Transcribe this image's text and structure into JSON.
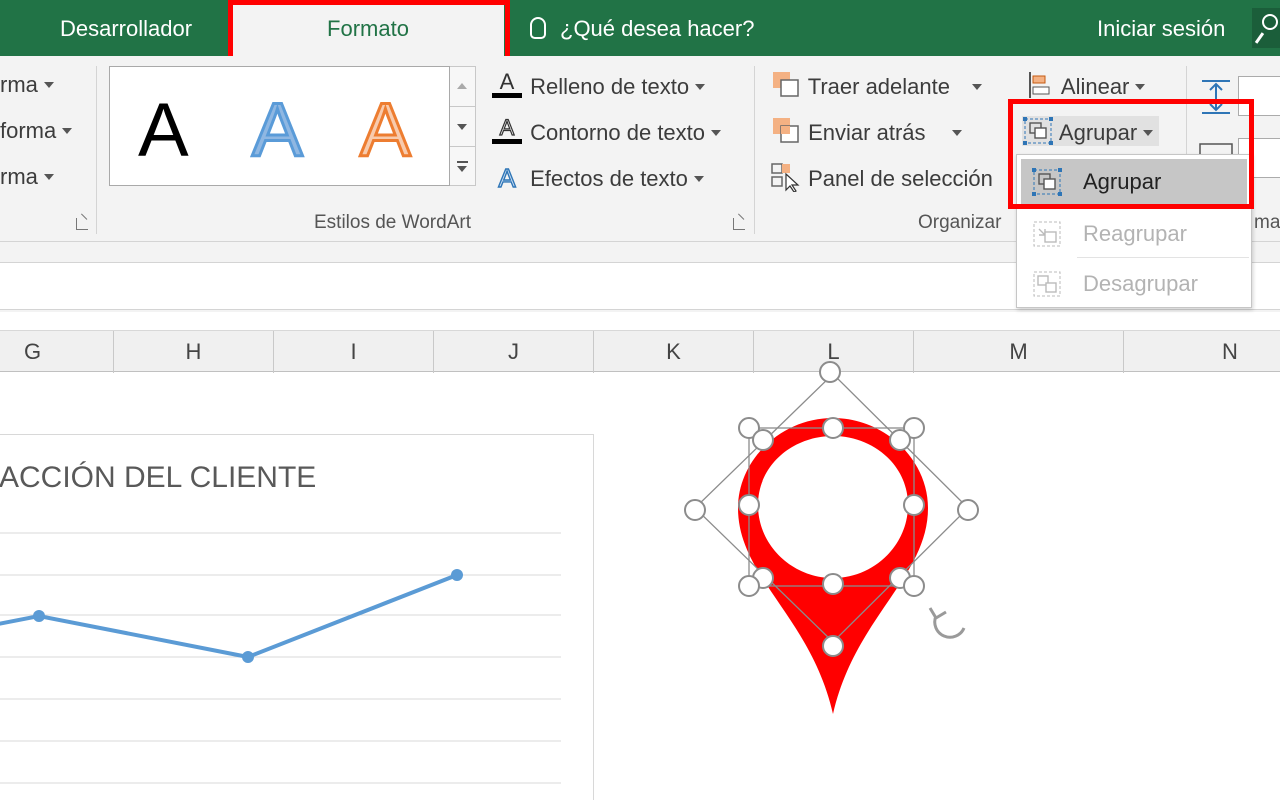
{
  "tabs": {
    "developer": "Desarrollador",
    "format": "Formato",
    "tell_me": "¿Qué desea hacer?",
    "sign_in": "Iniciar sesión"
  },
  "ribbon": {
    "shape_styles_partial": [
      "rma",
      "forma",
      "rma"
    ],
    "wordart": {
      "letters": [
        "A",
        "A",
        "A"
      ],
      "text_fill": "Relleno de texto",
      "text_outline": "Contorno de texto",
      "text_effects": "Efectos de texto",
      "group_label": "Estilos de WordArt"
    },
    "arrange": {
      "bring_forward": "Traer adelante",
      "send_backward": "Enviar atrás",
      "selection_pane": "Panel de selección",
      "align": "Alinear",
      "group": "Agrupar",
      "group_label_partial": "Organizar"
    },
    "size_group_partial": "ma"
  },
  "group_menu": {
    "items": [
      {
        "label": "Agrupar",
        "enabled": true
      },
      {
        "label": "Reagrupar",
        "enabled": false
      },
      {
        "label": "Desagrupar",
        "enabled": false
      }
    ]
  },
  "columns": [
    "G",
    "H",
    "I",
    "J",
    "K",
    "L",
    "M",
    "N"
  ],
  "chart_data": {
    "type": "line",
    "title": "ACCIÓN DEL CLIENTE",
    "series": [
      {
        "values": [
          3.5,
          4.5,
          3.5,
          5.5
        ]
      }
    ]
  },
  "colors": {
    "excel_green": "#217346",
    "highlight_red": "#ff0000",
    "marker_red": "#ff0000",
    "series_blue": "#5b9bd5"
  }
}
